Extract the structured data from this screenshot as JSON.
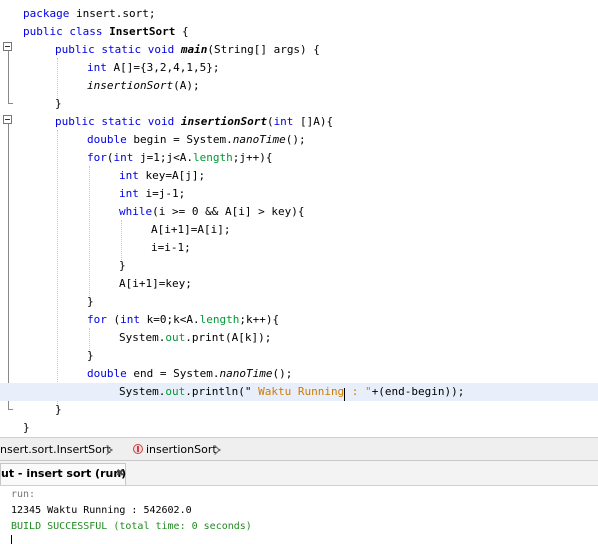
{
  "editor": {
    "lines": [
      {
        "segments": [
          {
            "text": "package",
            "style": "kw"
          },
          {
            "text": " insert.sort;",
            "style": ""
          }
        ]
      },
      {
        "segments": [
          {
            "text": "public class",
            "style": "kw"
          },
          {
            "text": " ",
            "style": ""
          },
          {
            "text": "InsertSort",
            "style": "bold"
          },
          {
            "text": " {",
            "style": ""
          }
        ]
      },
      {
        "segments": [
          {
            "text": "public static void",
            "style": "kw"
          },
          {
            "text": " ",
            "style": ""
          },
          {
            "text": "main",
            "style": "bi"
          },
          {
            "text": "(String[] args) {",
            "style": ""
          }
        ]
      },
      {
        "segments": [
          {
            "text": "int",
            "style": "kw"
          },
          {
            "text": " A[]={3,2,4,1,5};",
            "style": ""
          }
        ]
      },
      {
        "segments": [
          {
            "text": "insertionSort",
            "style": "ital"
          },
          {
            "text": "(A);",
            "style": ""
          }
        ]
      },
      {
        "segments": [
          {
            "text": "}",
            "style": ""
          }
        ]
      },
      {
        "segments": [
          {
            "text": "public static void",
            "style": "kw"
          },
          {
            "text": " ",
            "style": ""
          },
          {
            "text": "insertionSort",
            "style": "bi"
          },
          {
            "text": "(",
            "style": ""
          },
          {
            "text": "int",
            "style": "kw"
          },
          {
            "text": " []A){",
            "style": ""
          }
        ]
      },
      {
        "segments": [
          {
            "text": "double",
            "style": "kw"
          },
          {
            "text": " begin = System.",
            "style": ""
          },
          {
            "text": "nanoTime",
            "style": "ital"
          },
          {
            "text": "();",
            "style": ""
          }
        ]
      },
      {
        "segments": [
          {
            "text": "for",
            "style": "kw"
          },
          {
            "text": "(",
            "style": ""
          },
          {
            "text": "int",
            "style": "kw"
          },
          {
            "text": " j=1;j<A.",
            "style": ""
          },
          {
            "text": "length",
            "style": "field"
          },
          {
            "text": ";j++){",
            "style": ""
          }
        ]
      },
      {
        "segments": [
          {
            "text": "int",
            "style": "kw"
          },
          {
            "text": " key=A[j];",
            "style": ""
          }
        ]
      },
      {
        "segments": [
          {
            "text": "int",
            "style": "kw"
          },
          {
            "text": " i=j-1;",
            "style": ""
          }
        ]
      },
      {
        "segments": [
          {
            "text": "while",
            "style": "kw"
          },
          {
            "text": "(i >= 0 && A[i] > key){",
            "style": ""
          }
        ]
      },
      {
        "segments": [
          {
            "text": "A[i+1]=A[i];",
            "style": ""
          }
        ]
      },
      {
        "segments": [
          {
            "text": "i=i-1;",
            "style": ""
          }
        ]
      },
      {
        "segments": [
          {
            "text": "}",
            "style": ""
          }
        ]
      },
      {
        "segments": [
          {
            "text": "A[i+1]=key;",
            "style": ""
          }
        ]
      },
      {
        "segments": [
          {
            "text": "}",
            "style": ""
          }
        ]
      },
      {
        "segments": [
          {
            "text": "for",
            "style": "kw"
          },
          {
            "text": " (",
            "style": ""
          },
          {
            "text": "int",
            "style": "kw"
          },
          {
            "text": " k=0;k<A.",
            "style": ""
          },
          {
            "text": "length",
            "style": "field"
          },
          {
            "text": ";k++){",
            "style": ""
          }
        ]
      },
      {
        "segments": [
          {
            "text": "System.",
            "style": ""
          },
          {
            "text": "out",
            "style": "field"
          },
          {
            "text": ".print(A[k]);",
            "style": ""
          }
        ]
      },
      {
        "segments": [
          {
            "text": "}",
            "style": ""
          }
        ]
      },
      {
        "segments": [
          {
            "text": "double",
            "style": "kw"
          },
          {
            "text": " end = System.",
            "style": ""
          },
          {
            "text": "nanoTime",
            "style": "ital"
          },
          {
            "text": "();",
            "style": ""
          }
        ]
      },
      {
        "segments": [
          {
            "text": "System.",
            "style": ""
          },
          {
            "text": "out",
            "style": "field"
          },
          {
            "text": ".println(\"",
            "style": ""
          },
          {
            "text": " Waktu Running",
            "style": "str"
          },
          {
            "text": "|",
            "style": "caret"
          },
          {
            "text": " : \"",
            "style": "str"
          },
          {
            "text": "+(end-begin));",
            "style": ""
          }
        ]
      },
      {
        "segments": [
          {
            "text": "}",
            "style": ""
          }
        ]
      },
      {
        "segments": [
          {
            "text": "}",
            "style": ""
          }
        ]
      }
    ]
  },
  "breadcrumb": {
    "class_path": "nsert.sort.InsertSort",
    "method": "insertionSort"
  },
  "output_panel": {
    "tab_label": "ut - insert sort (run)",
    "close_glyph": "✖",
    "lines": {
      "run": "run:",
      "result": "12345 Waktu Running : 542602.0",
      "build": "BUILD SUCCESSFUL (total time: 0 seconds)"
    }
  },
  "colors": {
    "keyword": "#0000e6",
    "field": "#009933",
    "string": "#ce7b00",
    "build_success": "#228b22",
    "current_line": "#e9effa"
  }
}
